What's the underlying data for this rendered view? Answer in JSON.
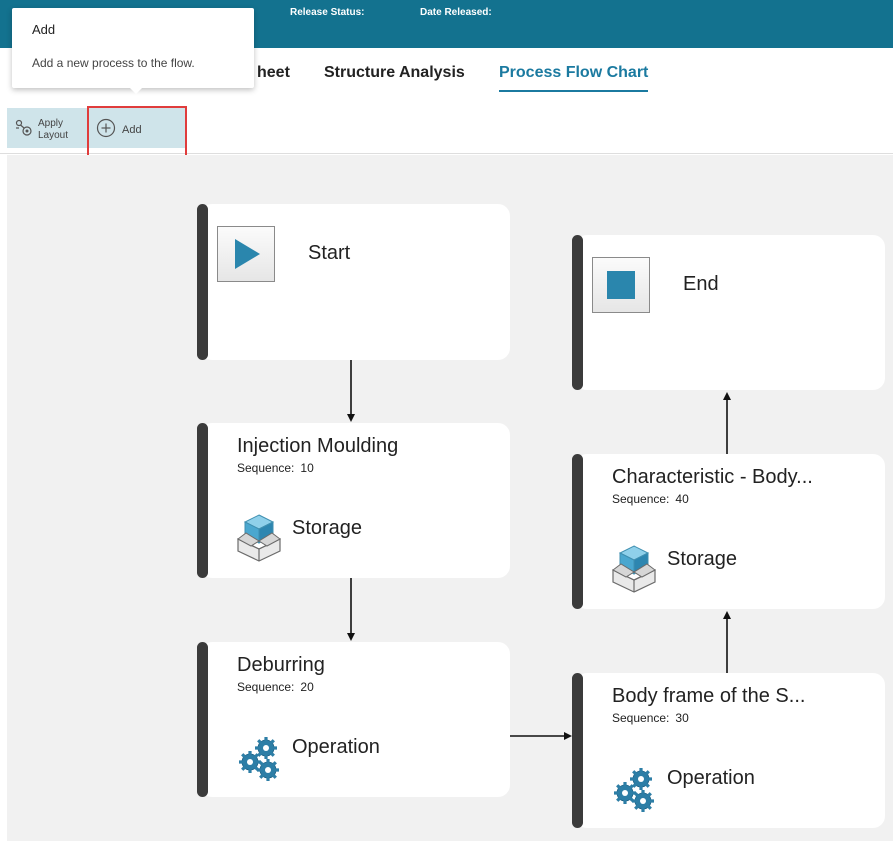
{
  "header": {
    "release_status_label": "Release Status:",
    "release_status_value": "",
    "date_released_label": "Date Released:",
    "date_released_value": ""
  },
  "tabs": [
    {
      "label": "heet"
    },
    {
      "label": "Structure Analysis"
    },
    {
      "label": "Process Flow Chart",
      "active": true
    }
  ],
  "toolbar": {
    "apply_layout_label": "Apply Layout",
    "add_label": "Add"
  },
  "tooltip": {
    "title": "Add",
    "description": "Add a new process to the flow."
  },
  "flow": {
    "start": {
      "label": "Start",
      "icon": "play-icon"
    },
    "end": {
      "label": "End",
      "icon": "stop-icon"
    },
    "sequence_label": "Sequence:",
    "processes": [
      {
        "title": "Injection Moulding",
        "sequence": "10",
        "type": "Storage",
        "icon": "storage-icon"
      },
      {
        "title": "Deburring",
        "sequence": "20",
        "type": "Operation",
        "icon": "gears-icon"
      },
      {
        "title": "Body frame of the S...",
        "sequence": "30",
        "type": "Operation",
        "icon": "gears-icon"
      },
      {
        "title": "Characteristic - Body...",
        "sequence": "40",
        "type": "Storage",
        "icon": "storage-icon"
      }
    ]
  },
  "colors": {
    "header_bg": "#13728f",
    "active_tab": "#1b7aa0",
    "highlight_border": "#e03c3c",
    "play_icon": "#2a86ad",
    "card_bar": "#3b3b3b",
    "canvas_bg": "#f1f1f1"
  }
}
